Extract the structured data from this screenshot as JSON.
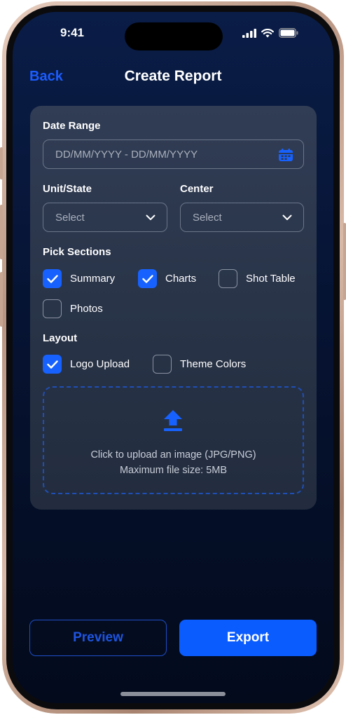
{
  "status_bar": {
    "time": "9:41"
  },
  "nav": {
    "back_label": "Back",
    "title": "Create Report"
  },
  "form": {
    "date_range": {
      "label": "Date Range",
      "placeholder": "DD/MM/YYYY - DD/MM/YYYY"
    },
    "unit_state": {
      "label": "Unit/State",
      "value": "Select"
    },
    "center": {
      "label": "Center",
      "value": "Select"
    },
    "pick_sections": {
      "label": "Pick Sections",
      "options": [
        {
          "label": "Summary",
          "checked": true
        },
        {
          "label": "Charts",
          "checked": true
        },
        {
          "label": "Shot Table",
          "checked": false
        },
        {
          "label": "Photos",
          "checked": false
        }
      ]
    },
    "layout": {
      "label": "Layout",
      "options": [
        {
          "label": "Logo Upload",
          "checked": true
        },
        {
          "label": "Theme Colors",
          "checked": false
        }
      ]
    },
    "upload": {
      "line1": "Click to upload an image (JPG/PNG)",
      "line2": "Maximum file size: 5MB"
    }
  },
  "actions": {
    "preview_label": "Preview",
    "export_label": "Export"
  },
  "colors": {
    "accent": "#0a5cff",
    "checkbox_checked": "#1762ff",
    "back_link": "#1b5cff",
    "background_top": "#0a1d47",
    "background_bottom": "#030a1c",
    "card": "#2b364b"
  },
  "icons": [
    "battery-icon",
    "wifi-icon",
    "signal-icon",
    "calendar-icon",
    "chevron-down-icon",
    "checkmark-icon",
    "upload-icon"
  ]
}
